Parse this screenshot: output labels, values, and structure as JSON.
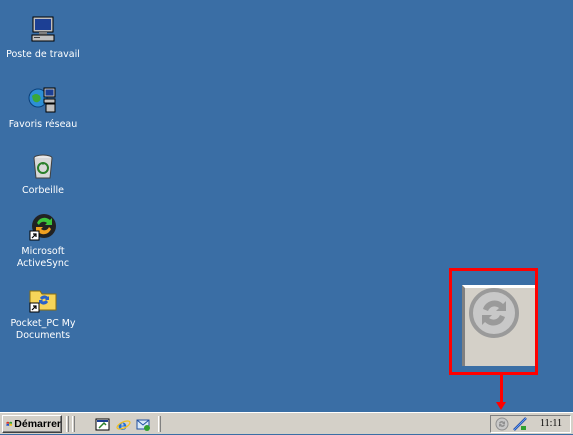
{
  "desktop": {
    "background_color": "#3a6ea5",
    "icons": [
      {
        "label": "Poste de travail",
        "icon": "my-computer-icon"
      },
      {
        "label": "Favoris réseau",
        "icon": "network-places-icon"
      },
      {
        "label": "Corbeille",
        "icon": "recycle-bin-icon"
      },
      {
        "label": "Microsoft ActiveSync",
        "icon": "activesync-icon"
      },
      {
        "label": "Pocket_PC My Documents",
        "icon": "pocketpc-documents-icon"
      }
    ]
  },
  "annotation": {
    "callout_icon": "activesync-tray-icon-enlarged",
    "highlight_color": "#ff0000"
  },
  "taskbar": {
    "start_label": "Démarrer",
    "quick_launch": [
      "show-desktop-icon",
      "internet-explorer-icon",
      "outlook-express-icon"
    ],
    "tray_icons": [
      "activesync-tray-icon",
      "connection-tray-icon"
    ],
    "clock": "11:11"
  }
}
